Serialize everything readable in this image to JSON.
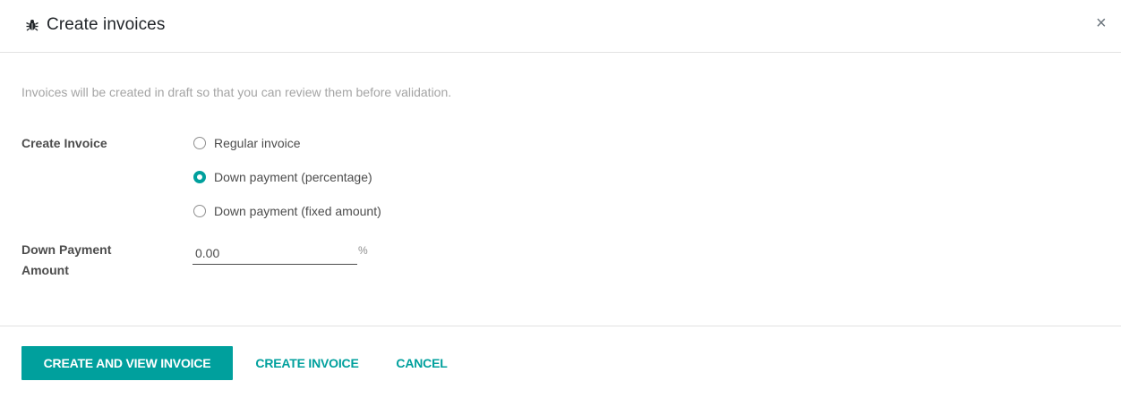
{
  "dialog": {
    "title": "Create invoices",
    "close_label": "×",
    "icon": "bug-icon"
  },
  "hint": "Invoices will be created in draft so that you can review them before validation.",
  "create_invoice": {
    "label": "Create Invoice",
    "options": [
      {
        "label": "Regular invoice",
        "checked": false
      },
      {
        "label": "Down payment (percentage)",
        "checked": true
      },
      {
        "label": "Down payment (fixed amount)",
        "checked": false
      }
    ]
  },
  "down_payment": {
    "label_line1": "Down Payment",
    "label_line2": "Amount",
    "value": "0.00",
    "unit": "%"
  },
  "footer": {
    "primary_label": "CREATE AND VIEW INVOICE",
    "secondary_label": "CREATE INVOICE",
    "cancel_label": "CANCEL"
  },
  "colors": {
    "accent": "#00a09d"
  }
}
